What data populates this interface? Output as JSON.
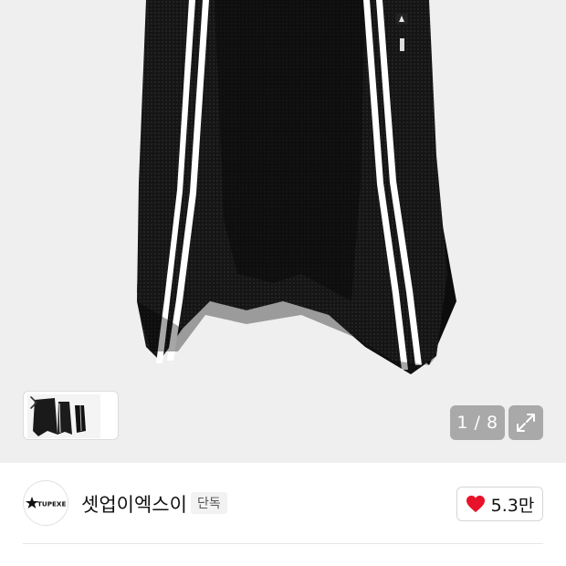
{
  "gallery": {
    "counter": "1 / 8",
    "thumbnail_icon": "chevron-right-icon",
    "expand_icon": "expand-icon"
  },
  "brand": {
    "logo_text": "STUPEXE",
    "name": "셋업이엑스이",
    "badge": "단독"
  },
  "like": {
    "icon": "heart-icon",
    "count": "5.3만",
    "color": "#e8132a"
  }
}
